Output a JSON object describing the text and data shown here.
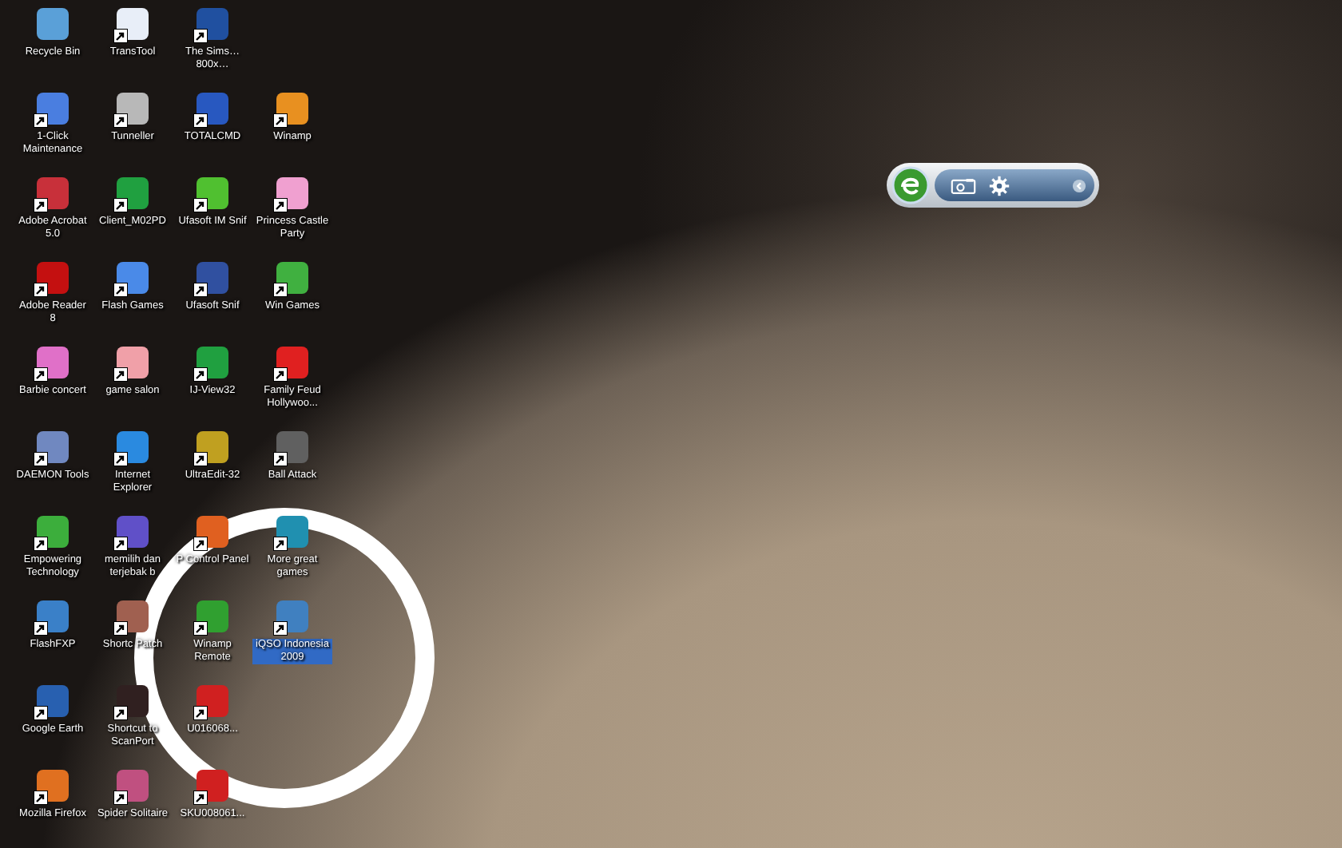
{
  "desktop": {
    "columns": [
      {
        "items": [
          {
            "label": "Recycle Bin",
            "color": "#5aa0d8",
            "shortcut": false,
            "selected": false
          },
          {
            "label": "1-Click Maintenance",
            "color": "#4a7ee0",
            "shortcut": true,
            "selected": false
          },
          {
            "label": "Adobe Acrobat 5.0",
            "color": "#c8303a",
            "shortcut": true,
            "selected": false
          },
          {
            "label": "Adobe Reader 8",
            "color": "#c41010",
            "shortcut": true,
            "selected": false
          },
          {
            "label": "Barbie concert",
            "color": "#e070c8",
            "shortcut": true,
            "selected": false
          },
          {
            "label": "DAEMON Tools",
            "color": "#7088c0",
            "shortcut": true,
            "selected": false
          },
          {
            "label": "Empowering Technology",
            "color": "#3cae3c",
            "shortcut": true,
            "selected": false
          },
          {
            "label": "FlashFXP",
            "color": "#3a80c8",
            "shortcut": true,
            "selected": false
          },
          {
            "label": "Google Earth",
            "color": "#2860b0",
            "shortcut": true,
            "selected": false
          },
          {
            "label": "Mozilla Firefox",
            "color": "#e07020",
            "shortcut": true,
            "selected": false
          }
        ]
      },
      {
        "items": [
          {
            "label": "TransTool",
            "color": "#e8eef8",
            "shortcut": true,
            "selected": false
          },
          {
            "label": "Tunneller",
            "color": "#b8b8b8",
            "shortcut": true,
            "selected": false
          },
          {
            "label": "Client_M02PD",
            "color": "#20a040",
            "shortcut": true,
            "selected": false
          },
          {
            "label": "Flash Games",
            "color": "#4a8ae8",
            "shortcut": true,
            "selected": false
          },
          {
            "label": "game salon",
            "color": "#f0a0a8",
            "shortcut": true,
            "selected": false
          },
          {
            "label": "Internet Explorer",
            "color": "#2a8ae0",
            "shortcut": true,
            "selected": false
          },
          {
            "label": "memilih dan terjebak b",
            "color": "#6050c8",
            "shortcut": true,
            "selected": false
          },
          {
            "label": "Shortc Patch",
            "color": "#a06050",
            "shortcut": true,
            "selected": false
          },
          {
            "label": "Shortcut to ScanPort",
            "color": "#302020",
            "shortcut": true,
            "selected": false
          },
          {
            "label": "Spider Solitaire",
            "color": "#c05080",
            "shortcut": true,
            "selected": false
          }
        ]
      },
      {
        "items": [
          {
            "label": "The Sims…800x…",
            "color": "#2050a0",
            "shortcut": true,
            "selected": false
          },
          {
            "label": "TOTALCMD",
            "color": "#2858c0",
            "shortcut": true,
            "selected": false
          },
          {
            "label": "Ufasoft IM Snif",
            "color": "#50c030",
            "shortcut": true,
            "selected": false
          },
          {
            "label": "Ufasoft Snif",
            "color": "#3050a0",
            "shortcut": true,
            "selected": false
          },
          {
            "label": "IJ-View32",
            "color": "#20a040",
            "shortcut": true,
            "selected": false
          },
          {
            "label": "UltraEdit-32",
            "color": "#c0a020",
            "shortcut": true,
            "selected": false
          },
          {
            "label": "P Control Panel",
            "color": "#e06020",
            "shortcut": true,
            "selected": false
          },
          {
            "label": "Winamp Remote",
            "color": "#30a030",
            "shortcut": true,
            "selected": false
          },
          {
            "label": "U016068...",
            "color": "#d02020",
            "shortcut": true,
            "selected": false
          },
          {
            "label": "SKU008061...",
            "color": "#d02020",
            "shortcut": true,
            "selected": false
          }
        ]
      },
      {
        "items": [
          {
            "label": "Winamp",
            "color": "#e89020",
            "shortcut": true,
            "selected": false
          },
          {
            "label": "Princess Castle Party",
            "color": "#f0a0d0",
            "shortcut": true,
            "selected": false
          },
          {
            "label": "Win Games",
            "color": "#40b040",
            "shortcut": true,
            "selected": false
          },
          {
            "label": "Family Feud Hollywoo...",
            "color": "#e02020",
            "shortcut": true,
            "selected": false
          },
          {
            "label": "Ball Attack",
            "color": "#606060",
            "shortcut": true,
            "selected": false
          },
          {
            "label": "More great games",
            "color": "#2090b0",
            "shortcut": true,
            "selected": false
          },
          {
            "label": "iQSO Indonesia 2009",
            "color": "#4080c0",
            "shortcut": true,
            "selected": true
          }
        ]
      }
    ]
  }
}
